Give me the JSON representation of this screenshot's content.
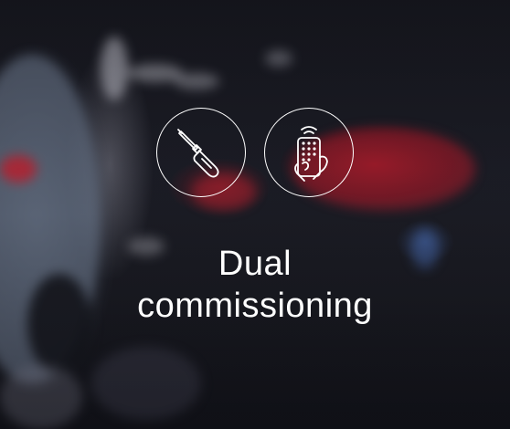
{
  "feature": {
    "title_line1": "Dual",
    "title_line2": "commissioning",
    "icons": [
      "screwdriver-icon",
      "remote-control-icon"
    ]
  },
  "colors": {
    "text": "#ffffff",
    "accent_taillight": "#be1e2d"
  }
}
